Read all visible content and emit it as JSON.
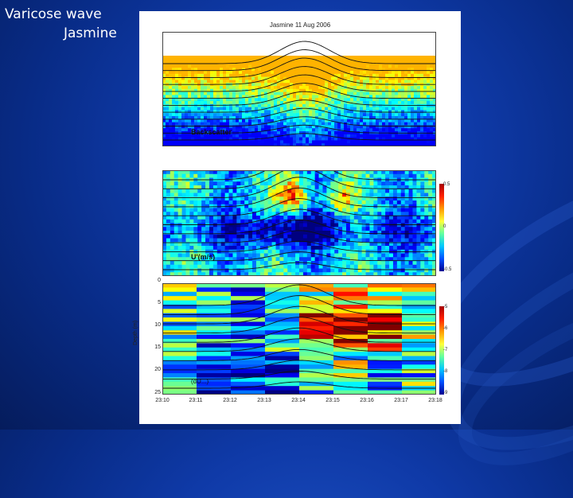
{
  "slide": {
    "title_line1": "Varicose wave",
    "title_line2": "Jasmine"
  },
  "figure": {
    "title": "Jasmine 11 Aug 2006",
    "panels": [
      {
        "label": "Backscatter",
        "colormap": "jet"
      },
      {
        "label": "U'(m/s)",
        "colormap": "jet",
        "colorbar_ticks": [
          "0.5",
          "0",
          "-0.5"
        ]
      },
      {
        "label": "(dU...)",
        "colormap": "jet",
        "colorbar_ticks": [
          "-5",
          "-6",
          "-7",
          "-8",
          "-9"
        ]
      }
    ],
    "y_axis_label": "Depth (m)",
    "y_ticks": [
      "0",
      "5",
      "10",
      "15",
      "20",
      "25"
    ],
    "x_ticks": [
      "23:10",
      "23:11",
      "23:12",
      "23:13",
      "23:14",
      "23:15",
      "23:16",
      "23:17",
      "23:18"
    ]
  },
  "colors": {
    "background": "#0f3aa8",
    "figure_bg": "#ffffff",
    "title_text": "#ffffff"
  }
}
